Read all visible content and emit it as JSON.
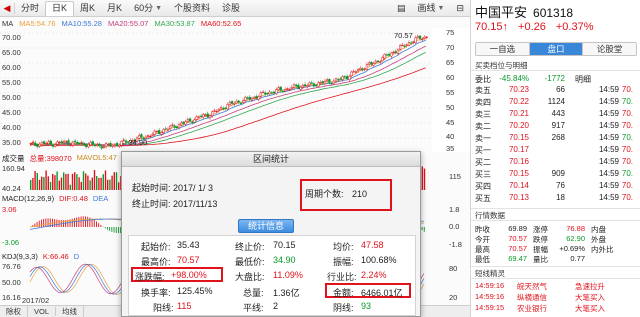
{
  "toolbar": {
    "tabs": [
      {
        "label": "分时",
        "active": false
      },
      {
        "label": "日K",
        "active": true
      },
      {
        "label": "周K",
        "active": false
      },
      {
        "label": "月K",
        "active": false
      },
      {
        "label": "60分",
        "active": false,
        "dropdown": true
      },
      {
        "label": "个股资料",
        "active": false
      },
      {
        "label": "诊股",
        "active": false
      }
    ],
    "right_tab": "画线"
  },
  "ma_legend": [
    {
      "label": "MA",
      "color": "#333333"
    },
    {
      "label": "MA5:54.76",
      "color": "#e8a33d"
    },
    {
      "label": "MA10:55.28",
      "color": "#3d7ad9"
    },
    {
      "label": "MA20:55.07",
      "color": "#c7407a"
    },
    {
      "label": "MA30:53.87",
      "color": "#33a853"
    },
    {
      "label": "MA60:52.65",
      "color": "#e0121b"
    }
  ],
  "main_axis": {
    "left": [
      "70.00",
      "65.00",
      "60.00",
      "55.00",
      "50.00",
      "45.00",
      "40.00",
      "35.00"
    ],
    "right": [
      "75",
      "70",
      "65",
      "60",
      "55",
      "50",
      "45",
      "40",
      "35"
    ]
  },
  "annotations": {
    "high": "70.57",
    "low": "←34.90"
  },
  "volume": {
    "title": "成交量",
    "total": "总量:398070",
    "mavol": "MAVOL5:47",
    "top_left": "160.94",
    "bottom_left": "40.24",
    "right": "115"
  },
  "macd": {
    "title": "MACD(12,26,9)",
    "dif": "DIF:0.48",
    "dea": "DEA",
    "top_left": "3.06",
    "bottom_left": "-3.06",
    "right": [
      "1.8",
      "0.0",
      "-1.8"
    ]
  },
  "kdj": {
    "title": "KDJ(9,3,3)",
    "k": "K:66.46",
    "d": "D",
    "left": [
      "76.76",
      "50.00",
      "16.16"
    ],
    "right": [
      "80",
      "20"
    ]
  },
  "bottom_bar": {
    "date": "2017/02",
    "items": [
      "除权",
      "VOL",
      "均线"
    ]
  },
  "dialog": {
    "title": "区间统计",
    "start_label": "起始时间:",
    "start_value": "2017/ 1/ 3",
    "end_label": "终止时间:",
    "end_value": "2017/11/13",
    "period_label": "周期个数:",
    "period_value": "210",
    "stats_button": "统计信息",
    "stats": {
      "start_price_label": "起始价:",
      "start_price": "35.43",
      "end_price_label": "终止价:",
      "end_price": "70.15",
      "avg_label": "均价:",
      "avg": "47.58",
      "high_label": "最高价:",
      "high": "70.57",
      "low_label": "最低价:",
      "low": "34.90",
      "amp_label": "振幅:",
      "amp": "100.68%",
      "change_label": "涨跌幅:",
      "change": "+98.00%",
      "market_label": "大盘比:",
      "market": "11.09%",
      "industry_label": "行业比:",
      "industry": "2.24%",
      "turnover_label": "换手率:",
      "turnover": "125.45%",
      "volume_label": "总量:",
      "volume": "1.36亿",
      "amount_label": "金额:",
      "amount": "6466.01亿",
      "up_label": "阳线:",
      "up": "115",
      "flat_label": "平线:",
      "flat": "2",
      "down_label": "阴线:",
      "down": "93"
    }
  },
  "stock": {
    "name": "中国平安",
    "code": "601318",
    "price": "70.15",
    "arrow": "↑",
    "change": "+0.26",
    "pct": "+0.37%",
    "tabs": [
      "一自选",
      "盘口",
      "论股堂"
    ],
    "active_tab": 1
  },
  "order_book": {
    "title": "买卖档位与明细",
    "weibi_label": "委比",
    "weibi": "-45.84%",
    "weicha": "-1772",
    "detail_label": "明细",
    "asks": [
      {
        "label": "卖五",
        "price": "70.23",
        "vol": "66"
      },
      {
        "label": "卖四",
        "price": "70.22",
        "vol": "1124"
      },
      {
        "label": "卖三",
        "price": "70.21",
        "vol": "443"
      },
      {
        "label": "卖二",
        "price": "70.20",
        "vol": "917"
      },
      {
        "label": "卖一",
        "price": "70.15",
        "vol": "268"
      }
    ],
    "bids": [
      {
        "label": "买一",
        "price": "70.17",
        "vol": "",
        "color": "red"
      },
      {
        "label": "买二",
        "price": "70.16",
        "vol": "",
        "color": "red"
      },
      {
        "label": "买三",
        "price": "70.15",
        "vol": "",
        "color": "red"
      },
      {
        "label": "买四",
        "price": "70.14",
        "vol": "",
        "color": "red"
      },
      {
        "label": "买五",
        "price": "70.13",
        "vol": "",
        "color": "red"
      }
    ],
    "ask_vols": [
      "66",
      "1124",
      "443",
      "917",
      "268"
    ],
    "bid_vols": [
      "",
      "",
      "",
      "",
      ""
    ],
    "times": [
      "14:59",
      "14:59",
      "14:59",
      "14:59",
      "14:59",
      "14:59",
      "14:59",
      "14:59",
      "14:59",
      "14:59"
    ],
    "detail_prices": [
      "70.",
      "70.",
      "70.",
      "70.",
      "70.",
      "70.",
      "70.",
      "70.",
      "70.",
      "70."
    ],
    "detail_vols": [
      "",
      "",
      "",
      "",
      "",
      "",
      "",
      "",
      "",
      ""
    ]
  },
  "bid_vols_visible": [
    "",
    "",
    "909",
    "76",
    "18"
  ],
  "bid_times": [
    "14:59",
    "14:59",
    "14:59",
    "14:59",
    "14:59"
  ],
  "quote": {
    "title": "行情数据",
    "rows": [
      {
        "l1": "昨收",
        "v1": "69.89",
        "l2": "涨停",
        "v2": "76.88",
        "l3": "内盘",
        "v3": ""
      },
      {
        "l1": "今开",
        "v1": "70.57",
        "l2": "跌停",
        "v2": "62.90",
        "l3": "外盘",
        "v3": ""
      },
      {
        "l1": "最高",
        "v1": "70.57",
        "l2": "振幅",
        "v2": "+0.69%",
        "l3": "内外比",
        "v3": ""
      },
      {
        "l1": "最低",
        "v1": "69.47",
        "l2": "量比",
        "v2": "0.77",
        "l3": "",
        "v3": ""
      }
    ]
  },
  "news": {
    "title": "短线精灵",
    "rows": [
      {
        "time": "14:59:16",
        "name": "皖天然气",
        "event": "急速拉升"
      },
      {
        "time": "14:59:16",
        "name": "纵横通信",
        "event": "大笔买入"
      },
      {
        "time": "14:59:15",
        "name": "农业银行",
        "event": "大笔买入"
      }
    ]
  },
  "colors": {
    "up": "#e0121b",
    "down": "#0a9a2a",
    "accent": "#3a86d9",
    "highlight_box": "#e0121b"
  },
  "chart_data": {
    "type": "candlestick",
    "period": "daily",
    "x_range": [
      "2017/01/03",
      "2017/11/13"
    ],
    "ylim": [
      33,
      73
    ],
    "high_marker": 70.57,
    "low_marker": 34.9,
    "close_series": [
      35.4,
      35.6,
      35.8,
      35.5,
      35.9,
      36.1,
      36.0,
      35.8,
      35.6,
      35.3,
      35.1,
      34.9,
      35.2,
      35.6,
      36.2,
      36.8,
      37.4,
      37.9,
      38.6,
      39.4,
      40.3,
      41.0,
      41.8,
      42.5,
      43.3,
      44.2,
      44.8,
      45.5,
      46.6,
      47.8,
      48.6,
      49.3,
      49.9,
      50.4,
      51.2,
      52.0,
      52.4,
      52.9,
      53.3,
      53.8,
      54.2,
      54.5,
      54.8,
      55.2,
      55.6,
      55.9,
      56.4,
      57.3,
      58.5,
      59.6,
      60.8,
      61.5,
      62.8,
      64.0,
      65.2,
      66.5,
      67.8,
      68.9,
      69.8,
      70.15
    ]
  }
}
